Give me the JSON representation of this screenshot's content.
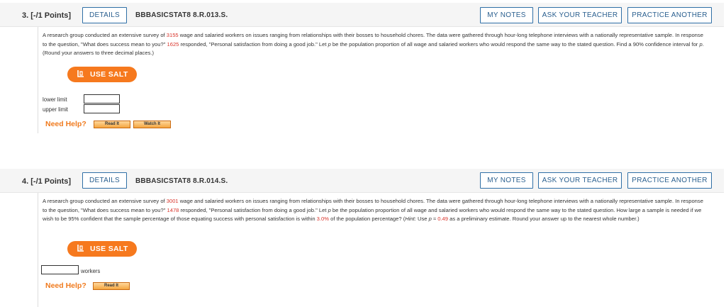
{
  "q3": {
    "number": "3.",
    "points": "[-/1 Points]",
    "details_label": "DETAILS",
    "code": "BBBASICSTAT8 8.R.013.S.",
    "my_notes_label": "MY NOTES",
    "ask_teacher_label": "ASK YOUR TEACHER",
    "practice_label": "PRACTICE ANOTHER",
    "text_1": "A research group conducted an extensive survey of ",
    "n_workers": "3155",
    "text_2": " wage and salaried workers on issues ranging from relationships with their bosses to household chores. The data were gathered through hour-long telephone interviews with a nationally representative sample. In response to the question, \"What does success mean to you?\" ",
    "n_responded": "1625",
    "text_3": " responded, \"Personal satisfaction from doing a good job.\" Let ",
    "p_symbol": "p",
    "text_4": " be the population proportion of all wage and salaried workers who would respond the same way to the stated question. Find a 90% confidence interval for ",
    "text_5": ". (Round your answers to three decimal places.)",
    "salt_label": "USE SALT",
    "lower_label": "lower limit",
    "upper_label": "upper limit",
    "lower_value": "",
    "upper_value": "",
    "need_help": "Need Help?",
    "read_it": "Read It",
    "watch_it": "Watch It"
  },
  "q4": {
    "number": "4.",
    "points": "[-/1 Points]",
    "details_label": "DETAILS",
    "code": "BBBASICSTAT8 8.R.014.S.",
    "my_notes_label": "MY NOTES",
    "ask_teacher_label": "ASK YOUR TEACHER",
    "practice_label": "PRACTICE ANOTHER",
    "text_1": "A research group conducted an extensive survey of ",
    "n_workers": "3001",
    "text_2": " wage and salaried workers on issues ranging from relationships with their bosses to household chores. The data were gathered through hour-long telephone interviews with a nationally representative sample. In response to the question, \"What does success mean to you?\" ",
    "n_responded": "1478",
    "text_3": " responded, \"Personal satisfaction from doing a good job.\" Let ",
    "p_symbol": "p",
    "text_4": " be the population proportion of all wage and salaried workers who would respond the same way to the stated question. How large a sample is needed if we wish to be 95% confident that the sample percentage of those equating success with personal satisfaction is within ",
    "margin": "3.0%",
    "text_5": " of the population percentage? (",
    "hint_label": "Hint:",
    "hint_text": " Use ",
    "hint_approx": " ≈ ",
    "p_estimate": "0.49",
    "text_6": " as a preliminary estimate. Round your answer up to the nearest whole number.)",
    "salt_label": "USE SALT",
    "answer_value": "",
    "unit_label": "workers",
    "need_help": "Need Help?",
    "read_it": "Read It"
  }
}
